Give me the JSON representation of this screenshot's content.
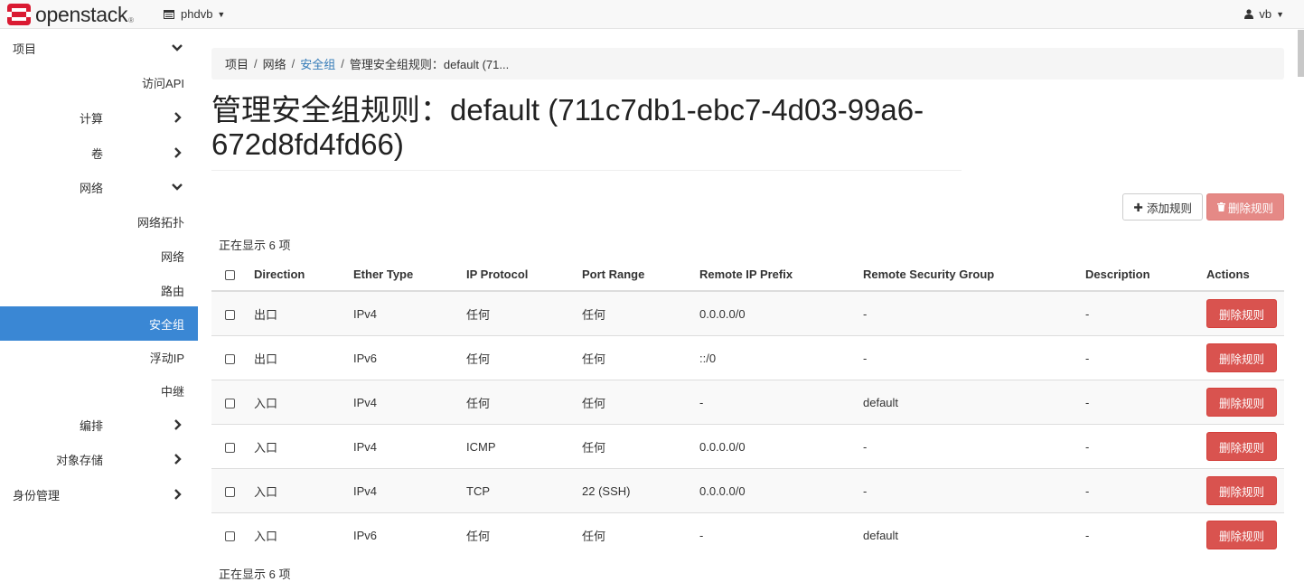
{
  "header": {
    "logo_text": "openstack",
    "logo_tm": "®",
    "project_name": "phdvb",
    "user_name": "vb"
  },
  "sidebar": {
    "items": [
      {
        "label": "项目",
        "level": 0,
        "chevron": "down",
        "active": false
      },
      {
        "label": "访问API",
        "level": 2,
        "chevron": null,
        "active": false
      },
      {
        "label": "计算",
        "level": 1,
        "chevron": "right",
        "active": false
      },
      {
        "label": "卷",
        "level": 1,
        "chevron": "right",
        "active": false
      },
      {
        "label": "网络",
        "level": 1,
        "chevron": "down",
        "active": false
      },
      {
        "label": "网络拓扑",
        "level": 2,
        "chevron": null,
        "active": false
      },
      {
        "label": "网络",
        "level": 2,
        "chevron": null,
        "active": false
      },
      {
        "label": "路由",
        "level": 2,
        "chevron": null,
        "active": false
      },
      {
        "label": "安全组",
        "level": 2,
        "chevron": null,
        "active": true
      },
      {
        "label": "浮动IP",
        "level": 2,
        "chevron": null,
        "active": false
      },
      {
        "label": "中继",
        "level": 2,
        "chevron": null,
        "active": false
      },
      {
        "label": "编排",
        "level": 1,
        "chevron": "right",
        "active": false
      },
      {
        "label": "对象存储",
        "level": 1,
        "chevron": "right",
        "active": false
      },
      {
        "label": "身份管理",
        "level": 0,
        "chevron": "right",
        "active": false
      }
    ]
  },
  "breadcrumb": {
    "items": [
      "项目",
      "网络",
      "安全组",
      "管理安全组规则：default (71..."
    ]
  },
  "page": {
    "title": "管理安全组规则：default (711c7db1-ebc7-4d03-99a6-672d8fd4fd66)"
  },
  "toolbar": {
    "add_rule_label": "添加规则",
    "delete_rules_label": "删除规则"
  },
  "table": {
    "count_text": "正在显示 6 项",
    "count_text_bottom": "正在显示 6 项",
    "columns": [
      "Direction",
      "Ether Type",
      "IP Protocol",
      "Port Range",
      "Remote IP Prefix",
      "Remote Security Group",
      "Description",
      "Actions"
    ],
    "rows": [
      {
        "direction": "出口",
        "ether_type": "IPv4",
        "ip_protocol": "任何",
        "port_range": "任何",
        "remote_ip_prefix": "0.0.0.0/0",
        "remote_sg": "-",
        "description": "-",
        "action": "删除规则"
      },
      {
        "direction": "出口",
        "ether_type": "IPv6",
        "ip_protocol": "任何",
        "port_range": "任何",
        "remote_ip_prefix": "::/0",
        "remote_sg": "-",
        "description": "-",
        "action": "删除规则"
      },
      {
        "direction": "入口",
        "ether_type": "IPv4",
        "ip_protocol": "任何",
        "port_range": "任何",
        "remote_ip_prefix": "-",
        "remote_sg": "default",
        "description": "-",
        "action": "删除规则"
      },
      {
        "direction": "入口",
        "ether_type": "IPv4",
        "ip_protocol": "ICMP",
        "port_range": "任何",
        "remote_ip_prefix": "0.0.0.0/0",
        "remote_sg": "-",
        "description": "-",
        "action": "删除规则"
      },
      {
        "direction": "入口",
        "ether_type": "IPv4",
        "ip_protocol": "TCP",
        "port_range": "22 (SSH)",
        "remote_ip_prefix": "0.0.0.0/0",
        "remote_sg": "-",
        "description": "-",
        "action": "删除规则"
      },
      {
        "direction": "入口",
        "ether_type": "IPv6",
        "ip_protocol": "任何",
        "port_range": "任何",
        "remote_ip_prefix": "-",
        "remote_sg": "default",
        "description": "-",
        "action": "删除规则"
      }
    ]
  },
  "colors": {
    "accent": "#3a87d4",
    "link": "#337ab7",
    "danger": "#d9534f",
    "danger_disabled": "#e58986",
    "logo_red": "#da1a32"
  }
}
